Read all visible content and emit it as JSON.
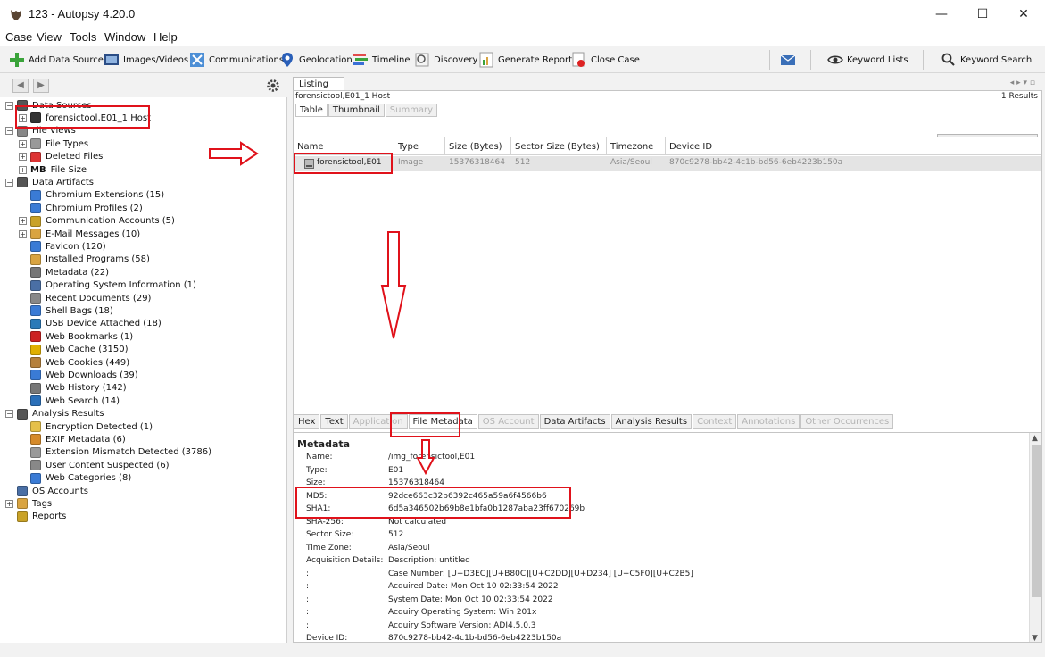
{
  "window": {
    "title": "123 - Autopsy 4.20.0",
    "minimize": "—",
    "maximize": "☐",
    "close": "✕"
  },
  "menu": [
    "Case",
    "View",
    "Tools",
    "Window",
    "Help"
  ],
  "toolbar": {
    "add_data_source": "Add Data Source",
    "images_videos": "Images/Videos",
    "communications": "Communications",
    "geolocation": "Geolocation",
    "timeline": "Timeline",
    "discovery": "Discovery",
    "generate_report": "Generate Report",
    "close_case": "Close Case",
    "keyword_lists": "Keyword Lists",
    "keyword_search": "Keyword Search"
  },
  "tree": [
    {
      "label": "Data Sources",
      "level": 0,
      "exp": "−",
      "color": "#555"
    },
    {
      "label": "forensictool,E01_1 Host",
      "level": 1,
      "exp": "+",
      "color": "#333"
    },
    {
      "label": "File Views",
      "level": 0,
      "exp": "−",
      "color": "#888"
    },
    {
      "label": "File Types",
      "level": 1,
      "exp": "+",
      "color": "#999"
    },
    {
      "label": "Deleted Files",
      "level": 1,
      "exp": "+",
      "color": "#d33"
    },
    {
      "label": "File Size",
      "level": 1,
      "exp": "+",
      "color": "#fff",
      "prefix": "MB"
    },
    {
      "label": "Data Artifacts",
      "level": 0,
      "exp": "−",
      "color": "#555"
    },
    {
      "label": "Chromium Extensions (15)",
      "level": 1,
      "exp": "",
      "color": "#3a7bd5"
    },
    {
      "label": "Chromium Profiles (2)",
      "level": 1,
      "exp": "",
      "color": "#3a7bd5"
    },
    {
      "label": "Communication Accounts (5)",
      "level": 1,
      "exp": "+",
      "color": "#c9a227"
    },
    {
      "label": "E-Mail Messages (10)",
      "level": 1,
      "exp": "+",
      "color": "#d9a441"
    },
    {
      "label": "Favicon (120)",
      "level": 1,
      "exp": "",
      "color": "#3a7bd5"
    },
    {
      "label": "Installed Programs (58)",
      "level": 1,
      "exp": "",
      "color": "#d9a441"
    },
    {
      "label": "Metadata (22)",
      "level": 1,
      "exp": "",
      "color": "#777"
    },
    {
      "label": "Operating System Information (1)",
      "level": 1,
      "exp": "",
      "color": "#4a6fa5"
    },
    {
      "label": "Recent Documents (29)",
      "level": 1,
      "exp": "",
      "color": "#888"
    },
    {
      "label": "Shell Bags (18)",
      "level": 1,
      "exp": "",
      "color": "#3a7bd5"
    },
    {
      "label": "USB Device Attached (18)",
      "level": 1,
      "exp": "",
      "color": "#2a7ab8"
    },
    {
      "label": "Web Bookmarks (1)",
      "level": 1,
      "exp": "",
      "color": "#cc2222"
    },
    {
      "label": "Web Cache (3150)",
      "level": 1,
      "exp": "",
      "color": "#e0b000"
    },
    {
      "label": "Web Cookies (449)",
      "level": 1,
      "exp": "",
      "color": "#b5803a"
    },
    {
      "label": "Web Downloads (39)",
      "level": 1,
      "exp": "",
      "color": "#3a7bd5"
    },
    {
      "label": "Web History (142)",
      "level": 1,
      "exp": "",
      "color": "#777"
    },
    {
      "label": "Web Search (14)",
      "level": 1,
      "exp": "",
      "color": "#2a6fb8"
    },
    {
      "label": "Analysis Results",
      "level": 0,
      "exp": "−",
      "color": "#555"
    },
    {
      "label": "Encryption Detected (1)",
      "level": 1,
      "exp": "",
      "color": "#e5c04a"
    },
    {
      "label": "EXIF Metadata (6)",
      "level": 1,
      "exp": "",
      "color": "#d58a2a"
    },
    {
      "label": "Extension Mismatch Detected (3786)",
      "level": 1,
      "exp": "",
      "color": "#999"
    },
    {
      "label": "User Content Suspected (6)",
      "level": 1,
      "exp": "",
      "color": "#888"
    },
    {
      "label": "Web Categories (8)",
      "level": 1,
      "exp": "",
      "color": "#3a7bd5"
    },
    {
      "label": "OS Accounts",
      "level": 0,
      "exp": "",
      "color": "#4a6fa5"
    },
    {
      "label": "Tags",
      "level": 0,
      "exp": "+",
      "color": "#d9a441"
    },
    {
      "label": "Reports",
      "level": 0,
      "exp": "",
      "color": "#c9a227"
    }
  ],
  "listing": {
    "tab": "Listing",
    "path": "forensictool,E01_1 Host",
    "results": "1  Results",
    "subtabs": [
      {
        "label": "Table",
        "state": "active"
      },
      {
        "label": "Thumbnail",
        "state": "normal"
      },
      {
        "label": "Summary",
        "state": "disabled"
      }
    ],
    "save_csv": "Save Table as CSV",
    "columns": [
      "Name",
      "Type",
      "Size (Bytes)",
      "Sector Size (Bytes)",
      "Timezone",
      "Device ID"
    ],
    "row": [
      "forensictool,E01",
      "Image",
      "15376318464",
      "512",
      "Asia/Seoul",
      "870c9278-bb42-4c1b-bd56-6eb4223b150a"
    ]
  },
  "bottom_tabs": [
    {
      "label": "Hex",
      "state": "normal"
    },
    {
      "label": "Text",
      "state": "normal"
    },
    {
      "label": "Application",
      "state": "disabled"
    },
    {
      "label": "File Metadata",
      "state": "active"
    },
    {
      "label": "OS Account",
      "state": "disabled"
    },
    {
      "label": "Data Artifacts",
      "state": "normal"
    },
    {
      "label": "Analysis Results",
      "state": "normal"
    },
    {
      "label": "Context",
      "state": "disabled"
    },
    {
      "label": "Annotations",
      "state": "disabled"
    },
    {
      "label": "Other Occurrences",
      "state": "disabled"
    }
  ],
  "metadata": {
    "heading": "Metadata",
    "rows": [
      {
        "k": "Name:",
        "v": "/img_forensictool,E01"
      },
      {
        "k": "Type:",
        "v": "E01"
      },
      {
        "k": "Size:",
        "v": "15376318464"
      },
      {
        "k": "MD5:",
        "v": "92dce663c32b6392c465a59a6f4566b6"
      },
      {
        "k": "SHA1:",
        "v": "6d5a346502b69b8e1bfa0b1287aba23ff670269b"
      },
      {
        "k": "SHA-256:",
        "v": "Not calculated"
      },
      {
        "k": "Sector Size:",
        "v": "512"
      },
      {
        "k": "Time Zone:",
        "v": "Asia/Seoul"
      },
      {
        "k": "Acquisition Details:",
        "v": "Description: untitled"
      },
      {
        "k": ":",
        "v": "Case Number: [U+D3EC][U+B80C][U+C2DD][U+D234] [U+C5F0][U+C2B5]"
      },
      {
        "k": ":",
        "v": "Acquired Date: Mon Oct 10 02:33:54 2022"
      },
      {
        "k": ":",
        "v": "System Date: Mon Oct 10 02:33:54 2022"
      },
      {
        "k": ":",
        "v": "Acquiry Operating System: Win 201x"
      },
      {
        "k": ":",
        "v": "Acquiry Software Version: ADI4,5,0,3"
      },
      {
        "k": "Device ID:",
        "v": "870c9278-bb42-4c1b-bd56-6eb4223b150a"
      }
    ]
  },
  "colors": {
    "highlight": "#e0121b",
    "row_selected": "#e4e4e4"
  }
}
